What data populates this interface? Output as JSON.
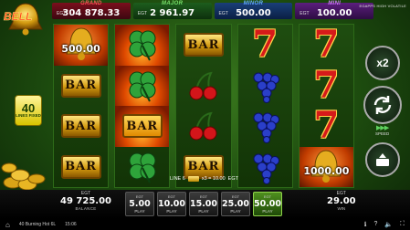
{
  "jackpots": [
    {
      "name": "GRAND",
      "currency": "EGT",
      "value": "304 878.33",
      "tier": "grand"
    },
    {
      "name": "MAJOR",
      "currency": "EGT",
      "value": "2 961.97",
      "tier": "major"
    },
    {
      "name": "MINOR",
      "currency": "EGT",
      "value": "500.00",
      "tier": "minor"
    },
    {
      "name": "MINI",
      "currency": "EGT",
      "value": "100.00",
      "tier": "mini"
    }
  ],
  "provider": "EGAPPS HIGH VOLATILE",
  "logo_text": "BELL",
  "lines_badge": {
    "number": "40",
    "text": "LINES FIXED"
  },
  "reels": {
    "reel1": {
      "top_amount": "500.00"
    },
    "reel5": {
      "bottom_amount": "1000.00"
    }
  },
  "symbols": {
    "bar": "BAR",
    "seven": "7"
  },
  "controls": {
    "multiplier": "x2",
    "speed_label": "SPEED",
    "speed_arrows": "▶▶▶"
  },
  "line_info": {
    "text": "LINE 6",
    "payout": "x3 = 10.00",
    "currency": "EGT"
  },
  "balance": {
    "currency": "EGT",
    "value": "49 725.00",
    "label": "BALANCE"
  },
  "win": {
    "currency": "EGT",
    "value": "29.00",
    "label": "WIN"
  },
  "bets": [
    {
      "currency": "EGT",
      "value": "5.00",
      "label": "PLAY",
      "active": false
    },
    {
      "currency": "EGT",
      "value": "10.00",
      "label": "PLAY",
      "active": false
    },
    {
      "currency": "EGT",
      "value": "15.00",
      "label": "PLAY",
      "active": false
    },
    {
      "currency": "EGT",
      "value": "25.00",
      "label": "PLAY",
      "active": false
    },
    {
      "currency": "EGT",
      "value": "50.00",
      "label": "PLAY",
      "active": true
    }
  ],
  "status": {
    "game_name": "40 Burning Hot 6L",
    "time": "15:06",
    "icons": [
      "i",
      "?",
      "speaker",
      "fullscreen"
    ]
  }
}
